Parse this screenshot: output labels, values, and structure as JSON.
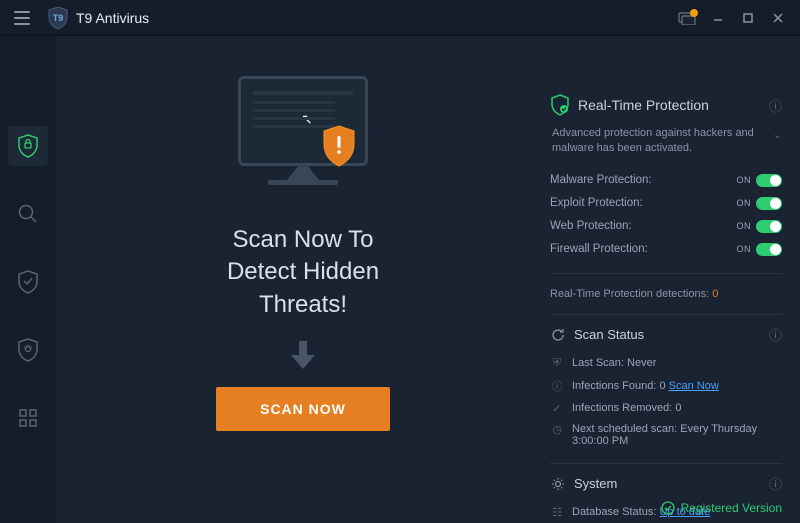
{
  "app": {
    "title": "T9 Antivirus"
  },
  "center": {
    "headline": "Scan Now To\nDetect Hidden\nThreats!",
    "scan_button": "SCAN NOW"
  },
  "realtime": {
    "title": "Real-Time Protection",
    "subtext": "Advanced protection against hackers and malware has been activated.",
    "rows": [
      {
        "label": "Malware Protection:",
        "state": "ON"
      },
      {
        "label": "Exploit Protection:",
        "state": "ON"
      },
      {
        "label": "Web Protection:",
        "state": "ON"
      },
      {
        "label": "Firewall Protection:",
        "state": "ON"
      }
    ],
    "detections_label": "Real-Time Protection detections:",
    "detections_count": "0"
  },
  "scan_status": {
    "title": "Scan Status",
    "last_scan_label": "Last Scan:",
    "last_scan_value": "Never",
    "infections_found_label": "Infections Found: 0",
    "scan_now_link": "Scan Now",
    "infections_removed_label": "Infections Removed: 0",
    "next_scan_label": "Next scheduled scan:",
    "next_scan_value": "Every Thursday 3:00:00 PM"
  },
  "system": {
    "title": "System",
    "db_label": "Database Status:",
    "db_value": "Up to date"
  },
  "footer": {
    "text": "Registered Version"
  }
}
